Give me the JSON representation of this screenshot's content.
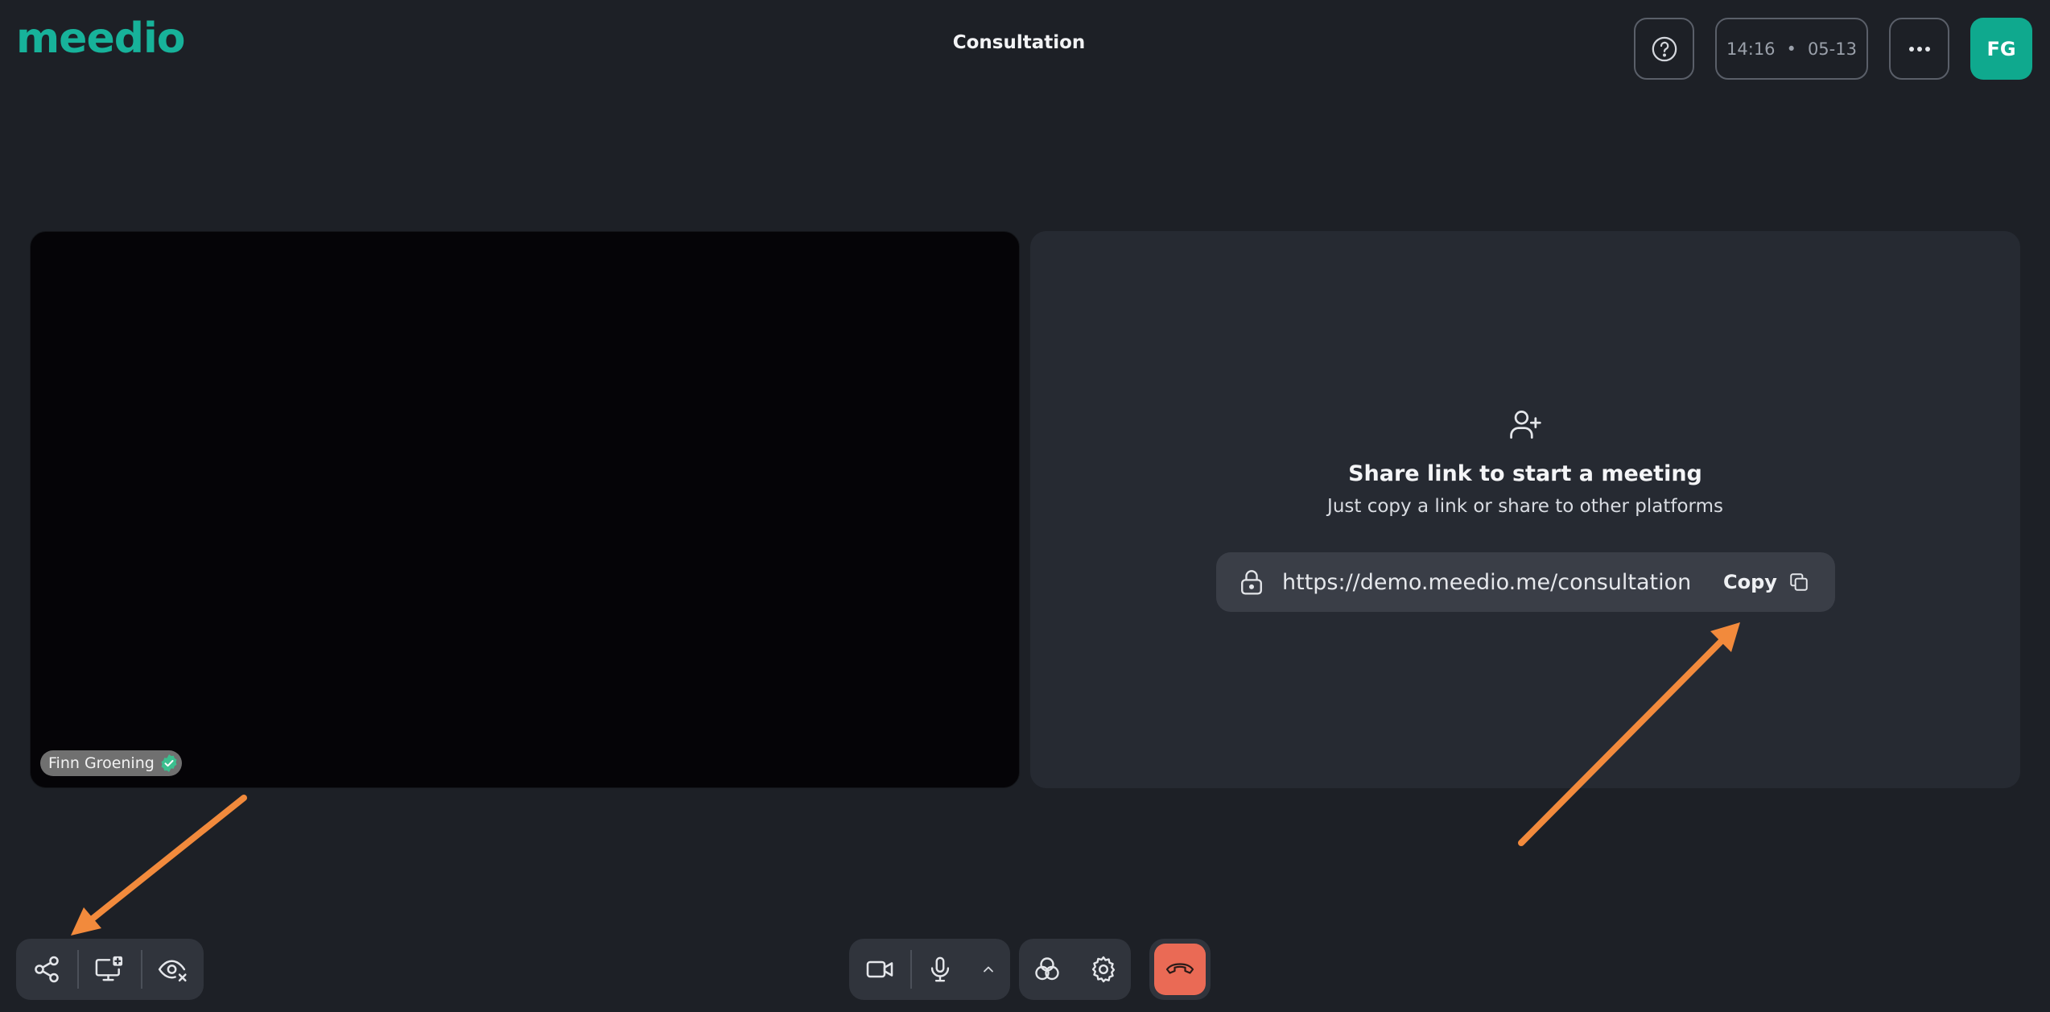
{
  "header": {
    "logo": "meedio",
    "title": "Consultation",
    "time": "14:16",
    "date": "05-13",
    "separator": "•",
    "avatar_initials": "FG"
  },
  "video_tile": {
    "participant_name": "Finn Groening"
  },
  "share_panel": {
    "heading": "Share link to start a meeting",
    "subtitle": "Just copy a link or share to other platforms",
    "link": "https://demo.meedio.me/consultation...",
    "copy_label": "Copy"
  },
  "icons": {
    "help": "help-circle-icon",
    "more": "more-horizontal-icon",
    "add_user": "user-plus-icon",
    "lock": "lock-icon",
    "copy": "copy-icon",
    "share": "share-icon",
    "screen_add": "screen-add-icon",
    "eye_off": "eye-off-icon",
    "camera": "video-camera-icon",
    "mic": "microphone-icon",
    "chevron": "chevron-up-icon",
    "effects": "effects-icon",
    "settings": "gear-icon",
    "end_call": "phone-hangup-icon"
  },
  "colors": {
    "brand": "#17b29a",
    "avatar": "#0fa98e",
    "end_call": "#ea6a55",
    "annotation_arrow": "#f28a3c",
    "background": "#1d2026",
    "panel": "#262a32"
  }
}
